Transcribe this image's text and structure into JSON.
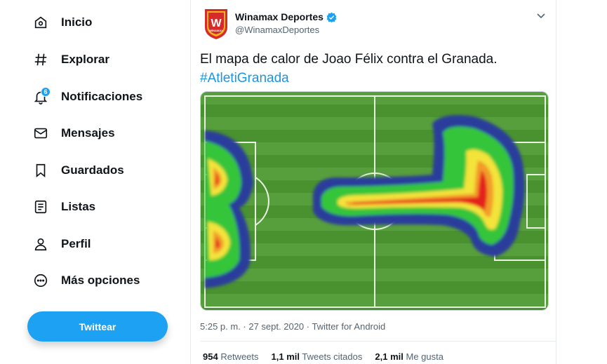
{
  "sidebar": {
    "items": [
      {
        "label": "Inicio",
        "icon": "home-icon"
      },
      {
        "label": "Explorar",
        "icon": "hashtag-icon"
      },
      {
        "label": "Notificaciones",
        "icon": "bell-icon",
        "badge": "6"
      },
      {
        "label": "Mensajes",
        "icon": "envelope-icon"
      },
      {
        "label": "Guardados",
        "icon": "bookmark-icon"
      },
      {
        "label": "Listas",
        "icon": "list-icon"
      },
      {
        "label": "Perfil",
        "icon": "person-icon"
      },
      {
        "label": "Más opciones",
        "icon": "more-circle-icon"
      }
    ],
    "tweet_button": "Twittear"
  },
  "tweet": {
    "author_name": "Winamax Deportes",
    "handle": "@WinamaxDeportes",
    "text": "El mapa de calor de Joao Félix contra el Granada.",
    "hashtag": "#AtletiGranada",
    "timestamp": "5:25 p. m. · 27 sept. 2020 · Twitter for Android",
    "stats": {
      "retweets_count": "954",
      "retweets_label": "Retweets",
      "quotes_count": "1,1 mil",
      "quotes_label": "Tweets citados",
      "likes_count": "2,1 mil",
      "likes_label": "Me gusta"
    },
    "avatar_logo_text": "W",
    "avatar_logo_caption": "WINAMAX"
  },
  "colors": {
    "accent": "#1da1f2",
    "hashtag": "#1b95e0",
    "pitch_green": "#4e9a32",
    "heat_blue": "#2b3e9b",
    "heat_green": "#35c53a",
    "heat_yellow": "#f3e33a",
    "heat_orange": "#f39c2a",
    "heat_red": "#e3231d"
  }
}
